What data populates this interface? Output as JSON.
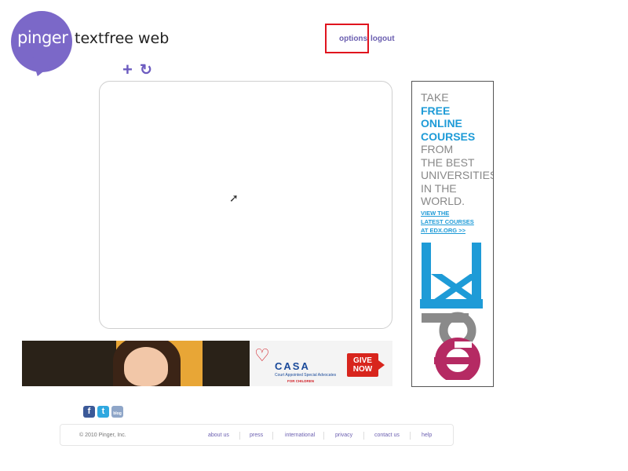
{
  "header": {
    "logo_text": "pinger",
    "app_title": "textfree web",
    "options_label": "options",
    "logout_label": "logout"
  },
  "toolbar": {
    "icons": [
      "plus-icon",
      "refresh-icon"
    ]
  },
  "side_ad": {
    "line1": "TAKE",
    "line2": "FREE",
    "line3": "ONLINE",
    "line4": "COURSES",
    "line5": "FROM",
    "line6": "THE BEST",
    "line7": "UNIVERSITIES",
    "line8": "IN THE",
    "line9": "WORLD.",
    "cta1": "VIEW THE",
    "cta2": "LATEST COURSES",
    "cta3": "AT EDX.ORG >>",
    "brand": "edX"
  },
  "banner": {
    "org": "CASA",
    "org_sub": "Court Appointed Special Advocates",
    "org_sub2": "FOR CHILDREN",
    "button_line1": "GIVE",
    "button_line2": "NOW"
  },
  "social": [
    "f",
    "t",
    "blog"
  ],
  "footer": {
    "copyright": "© 2010 Pinger, Inc.",
    "links": [
      "about us",
      "press",
      "international",
      "privacy",
      "contact us",
      "help"
    ]
  },
  "colors": {
    "brand_purple": "#7b68c8",
    "link_purple": "#6b5fb0",
    "highlight_red": "#e0141e",
    "edx_blue": "#1e9bd7",
    "edx_pink": "#b52a63"
  }
}
